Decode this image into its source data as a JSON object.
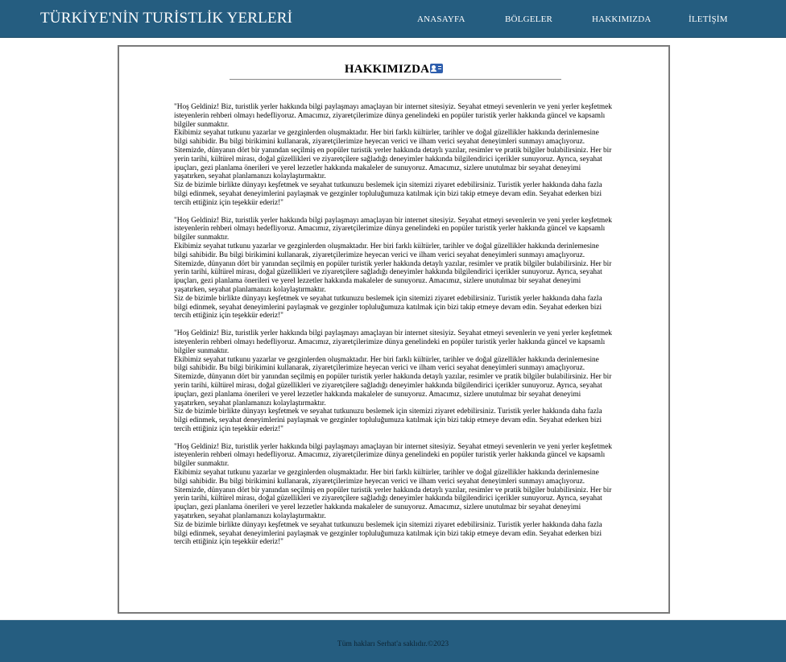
{
  "header": {
    "site_title": "TÜRKİYE'NİN TURİSTLİK YERLERİ",
    "nav": [
      "ANASAYFA",
      "BÖLGELER",
      "HAKKIMIZDA",
      "İLETİŞİM"
    ]
  },
  "main": {
    "heading": "HAKKIMIZDA",
    "heading_icon": "id-card-icon",
    "paragraphs": [
      "\"Hoş Geldiniz! Biz, turistlik yerler hakkında bilgi paylaşmayı amaçlayan bir internet sitesiyiz. Seyahat etmeyi sevenlerin ve yeni yerler keşfetmek isteyenlerin rehberi olmayı hedefliyoruz. Amacımız, ziyaretçilerimize dünya genelindeki en popüler turistik yerler hakkında güncel ve kapsamlı bilgiler sunmaktır.\nEkibimiz seyahat tutkunu yazarlar ve gezginlerden oluşmaktadır. Her biri farklı kültürler, tarihler ve doğal güzellikler hakkında derinlemesine bilgi sahibidir. Bu bilgi birikimini kullanarak, ziyaretçilerimize heyecan verici ve ilham verici seyahat deneyimleri sunmayı amaçlıyoruz.\nSitemizde, dünyanın dört bir yanından seçilmiş en popüler turistik yerler hakkında detaylı yazılar, resimler ve pratik bilgiler bulabilirsiniz. Her bir yerin tarihi, kültürel mirası, doğal güzellikleri ve ziyaretçilere sağladığı deneyimler hakkında bilgilendirici içerikler sunuyoruz. Ayrıca, seyahat ipuçları, gezi planlama önerileri ve yerel lezzetler hakkında makaleler de sunuyoruz. Amacımız, sizlere unutulmaz bir seyahat deneyimi yaşatırken, seyahat planlamanızı kolaylaştırmaktır.\nSiz de bizimle birlikte dünyayı keşfetmek ve seyahat tutkunuzu beslemek için sitemizi ziyaret edebilirsiniz. Turistik yerler hakkında daha fazla bilgi edinmek, seyahat deneyimlerini paylaşmak ve gezginler topluluğumuza katılmak için bizi takip etmeye devam edin. Seyahat ederken bizi tercih ettiğiniz için teşekkür ederiz!\"",
      "\"Hoş Geldiniz! Biz, turistlik yerler hakkında bilgi paylaşmayı amaçlayan bir internet sitesiyiz. Seyahat etmeyi sevenlerin ve yeni yerler keşfetmek isteyenlerin rehberi olmayı hedefliyoruz. Amacımız, ziyaretçilerimize dünya genelindeki en popüler turistik yerler hakkında güncel ve kapsamlı bilgiler sunmaktır.\nEkibimiz seyahat tutkunu yazarlar ve gezginlerden oluşmaktadır. Her biri farklı kültürler, tarihler ve doğal güzellikler hakkında derinlemesine bilgi sahibidir. Bu bilgi birikimini kullanarak, ziyaretçilerimize heyecan verici ve ilham verici seyahat deneyimleri sunmayı amaçlıyoruz.\nSitemizde, dünyanın dört bir yanından seçilmiş en popüler turistik yerler hakkında detaylı yazılar, resimler ve pratik bilgiler bulabilirsiniz. Her bir yerin tarihi, kültürel mirası, doğal güzellikleri ve ziyaretçilere sağladığı deneyimler hakkında bilgilendirici içerikler sunuyoruz. Ayrıca, seyahat ipuçları, gezi planlama önerileri ve yerel lezzetler hakkında makaleler de sunuyoruz. Amacımız, sizlere unutulmaz bir seyahat deneyimi yaşatırken, seyahat planlamanızı kolaylaştırmaktır.\nSiz de bizimle birlikte dünyayı keşfetmek ve seyahat tutkunuzu beslemek için sitemizi ziyaret edebilirsiniz. Turistik yerler hakkında daha fazla bilgi edinmek, seyahat deneyimlerini paylaşmak ve gezginler topluluğumuza katılmak için bizi takip etmeye devam edin. Seyahat ederken bizi tercih ettiğiniz için teşekkür ederiz!\"",
      "\"Hoş Geldiniz! Biz, turistlik yerler hakkında bilgi paylaşmayı amaçlayan bir internet sitesiyiz. Seyahat etmeyi sevenlerin ve yeni yerler keşfetmek isteyenlerin rehberi olmayı hedefliyoruz. Amacımız, ziyaretçilerimize dünya genelindeki en popüler turistik yerler hakkında güncel ve kapsamlı bilgiler sunmaktır.\nEkibimiz seyahat tutkunu yazarlar ve gezginlerden oluşmaktadır. Her biri farklı kültürler, tarihler ve doğal güzellikler hakkında derinlemesine bilgi sahibidir. Bu bilgi birikimini kullanarak, ziyaretçilerimize heyecan verici ve ilham verici seyahat deneyimleri sunmayı amaçlıyoruz.\nSitemizde, dünyanın dört bir yanından seçilmiş en popüler turistik yerler hakkında detaylı yazılar, resimler ve pratik bilgiler bulabilirsiniz. Her bir yerin tarihi, kültürel mirası, doğal güzellikleri ve ziyaretçilere sağladığı deneyimler hakkında bilgilendirici içerikler sunuyoruz. Ayrıca, seyahat ipuçları, gezi planlama önerileri ve yerel lezzetler hakkında makaleler de sunuyoruz. Amacımız, sizlere unutulmaz bir seyahat deneyimi yaşatırken, seyahat planlamanızı kolaylaştırmaktır.\nSiz de bizimle birlikte dünyayı keşfetmek ve seyahat tutkunuzu beslemek için sitemizi ziyaret edebilirsiniz. Turistik yerler hakkında daha fazla bilgi edinmek, seyahat deneyimlerini paylaşmak ve gezginler topluluğumuza katılmak için bizi takip etmeye devam edin. Seyahat ederken bizi tercih ettiğiniz için teşekkür ederiz!\"",
      "\"Hoş Geldiniz! Biz, turistlik yerler hakkında bilgi paylaşmayı amaçlayan bir internet sitesiyiz. Seyahat etmeyi sevenlerin ve yeni yerler keşfetmek isteyenlerin rehberi olmayı hedefliyoruz. Amacımız, ziyaretçilerimize dünya genelindeki en popüler turistik yerler hakkında güncel ve kapsamlı bilgiler sunmaktır.\nEkibimiz seyahat tutkunu yazarlar ve gezginlerden oluşmaktadır. Her biri farklı kültürler, tarihler ve doğal güzellikler hakkında derinlemesine bilgi sahibidir. Bu bilgi birikimini kullanarak, ziyaretçilerimize heyecan verici ve ilham verici seyahat deneyimleri sunmayı amaçlıyoruz.\nSitemizde, dünyanın dört bir yanından seçilmiş en popüler turistik yerler hakkında detaylı yazılar, resimler ve pratik bilgiler bulabilirsiniz. Her bir yerin tarihi, kültürel mirası, doğal güzellikleri ve ziyaretçilere sağladığı deneyimler hakkında bilgilendirici içerikler sunuyoruz. Ayrıca, seyahat ipuçları, gezi planlama önerileri ve yerel lezzetler hakkında makaleler de sunuyoruz. Amacımız, sizlere unutulmaz bir seyahat deneyimi yaşatırken, seyahat planlamanızı kolaylaştırmaktır.\nSiz de bizimle birlikte dünyayı keşfetmek ve seyahat tutkunuzu beslemek için sitemizi ziyaret edebilirsiniz. Turistik yerler hakkında daha fazla bilgi edinmek, seyahat deneyimlerini paylaşmak ve gezginler topluluğumuza katılmak için bizi takip etmeye devam edin. Seyahat ederken bizi tercih ettiğiniz için teşekkür ederiz!\""
    ]
  },
  "footer": {
    "text": "Tüm hakları Serhat'a saklıdır.©2023"
  },
  "colors": {
    "header_bg": "#255d80",
    "footer_bg": "#255d80",
    "panel_border": "#7a7a7a",
    "icon_blue": "#2f5fae"
  }
}
